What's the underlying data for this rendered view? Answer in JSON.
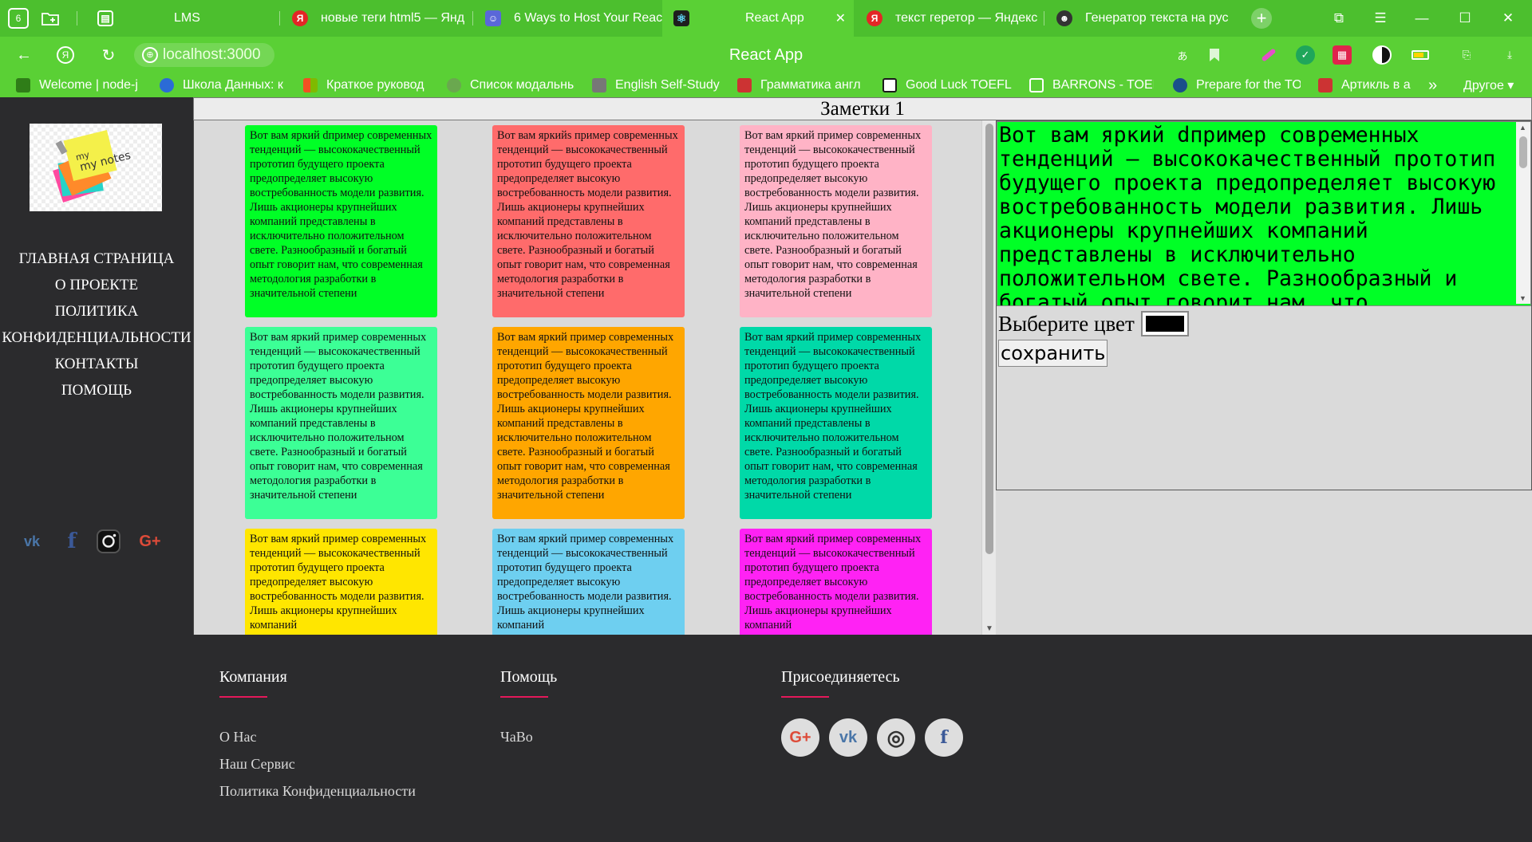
{
  "browser": {
    "tab_counter": "6",
    "tabs": [
      {
        "title": "LMS",
        "color": "#4cbf2e",
        "icon": "lms-icon"
      },
      {
        "title": "новые теги html5 — Янд",
        "color": "#e32626",
        "icon": "yandex-icon"
      },
      {
        "title": "6 Ways to Host Your Reac",
        "color": "#5a67d8",
        "icon": "avatar-icon"
      },
      {
        "title": "React App",
        "color": "#1e1e1e",
        "icon": "react-icon"
      },
      {
        "title": "текст геретор — Яндекс",
        "color": "#e32626",
        "icon": "yandex-icon"
      },
      {
        "title": "Генератор текста на рус",
        "color": "#333333",
        "icon": "face-icon"
      }
    ],
    "url": "localhost:3000",
    "page_title": "React App",
    "bookmarks": [
      {
        "title": "Welcome | node-j",
        "color": "#3a8a1a"
      },
      {
        "title": "Школа Данных: к",
        "color": "#2b6bd6"
      },
      {
        "title": "Краткое руковод",
        "color": "#f25022"
      },
      {
        "title": "Список модальны",
        "color": "#6aa84f"
      },
      {
        "title": "English Self-Study",
        "color": "#888888"
      },
      {
        "title": "Грамматика англ",
        "color": "#cc3333"
      },
      {
        "title": "Good Luck TOEFL",
        "color": "#1a1a1a"
      },
      {
        "title": "BARRONS - TOEFL",
        "color": "#ffffff"
      },
      {
        "title": "Prepare for the TO",
        "color": "#1a4f8a"
      },
      {
        "title": "Артикль в а",
        "color": "#cc3333"
      }
    ],
    "bookmarks_more": "»",
    "bookmarks_other": "Другое ▾"
  },
  "sidebar": {
    "logo_text": "my notes",
    "menu": [
      "ГЛАВНАЯ СТРАНИЦА",
      "О ПРОЕКТЕ",
      "ПОЛИТИКА",
      "КОНФИДЕНЦИАЛЬНОСТИ",
      "КОНТАКТЫ",
      "ПОМОЩЬ"
    ],
    "social": [
      "vk-icon",
      "facebook-icon",
      "instagram-icon",
      "google-plus-icon"
    ]
  },
  "main": {
    "title": "Заметки 1",
    "notes": [
      {
        "text": "Вот вам яркий dпример современных тенденций — высококачественный прототип будущего проекта предопределяет высокую востребованность модели развития. Лишь акционеры крупнейших компаний представлены в исключительно положительном свете. Разнообразный и богатый опыт говорит нам, что современная методология разработки в значительной степени",
        "color": "#00ff26"
      },
      {
        "text": "Вот вам яркийs пример современных тенденций — высококачественный прототип будущего проекта предопределяет высокую востребованность модели развития. Лишь акционеры крупнейших компаний представлены в исключительно положительном свете. Разнообразный и богатый опыт говорит нам, что современная методология разработки в значительной степени",
        "color": "#ff6b6b"
      },
      {
        "text": "Вот вам яркий пример современных тенденций — высококачественный прототип будущего проекта предопределяет высокую востребованность модели развития. Лишь акционеры крупнейших компаний представлены в исключительно положительном свете. Разнообразный и богатый опыт говорит нам, что современная методология разработки в значительной степени",
        "color": "#ffb3c6"
      },
      {
        "text": "Вот вам яркий пример современных тенденций — высококачественный прототип будущего проекта предопределяет высокую востребованность модели развития. Лишь акционеры крупнейших компаний представлены в исключительно положительном свете. Разнообразный и богатый опыт говорит нам, что современная методология разработки в значительной степени",
        "color": "#3cff96"
      },
      {
        "text": "Вот вам яркий пример современных тенденций — высококачественный прототип будущего проекта предопределяет высокую востребованность модели развития. Лишь акционеры крупнейших компаний представлены в исключительно положительном свете. Разнообразный и богатый опыт говорит нам, что современная методология разработки в значительной степени",
        "color": "#ffa600"
      },
      {
        "text": "Вот вам яркий пример современных тенденций — высококачественный прототип будущего проекта предопределяет высокую востребованность модели развития. Лишь акционеры крупнейших компаний представлены в исключительно положительном свете. Разнообразный и богатый опыт говорит нам, что современная методология разработки в значительной степени",
        "color": "#00d9a8"
      },
      {
        "text": "Вот вам яркий пример современных тенденций — высококачественный прототип будущего проекта предопределяет высокую востребованность модели развития. Лишь акционеры крупнейших компаний",
        "color": "#ffe600"
      },
      {
        "text": "Вот вам яркий пример современных тенденций — высококачественный прототип будущего проекта предопределяет высокую востребованность модели развития. Лишь акционеры крупнейших компаний",
        "color": "#6ecff0"
      },
      {
        "text": "Вот вам яркий пример современных тенденций — высококачественный прототип будущего проекта предопределяет высокую востребованность модели развития. Лишь акционеры крупнейших компаний",
        "color": "#ff22f4"
      }
    ]
  },
  "editor": {
    "text": "Вот вам яркий dпример современных тенденций — высококачественный прототип будущего проекта предопределяет высокую востребованность модели развития. Лишь акционеры крупнейших компаний представлены в исключительно положительном свете. Разнообразный и богатый опыт говорит нам, что современная",
    "color_label": "Выберите цвет",
    "color_value": "#000000",
    "save_label": "сохранить"
  },
  "footer": {
    "columns": [
      {
        "title": "Компания",
        "links": [
          "О Нас",
          "Наш Сервис",
          "Политика Конфиденциальности"
        ]
      },
      {
        "title": "Помощь",
        "links": [
          "ЧаВо"
        ]
      },
      {
        "title": "Присоединяетесь",
        "links": []
      }
    ],
    "social": [
      {
        "icon": "google-plus-icon",
        "glyph": "G+",
        "color": "#dd4b39"
      },
      {
        "icon": "vk-icon",
        "glyph": "vk",
        "color": "#4a76a8"
      },
      {
        "icon": "instagram-icon",
        "glyph": "◎",
        "color": "#333333"
      },
      {
        "icon": "facebook-icon",
        "glyph": "f",
        "color": "#3b5998"
      }
    ]
  }
}
